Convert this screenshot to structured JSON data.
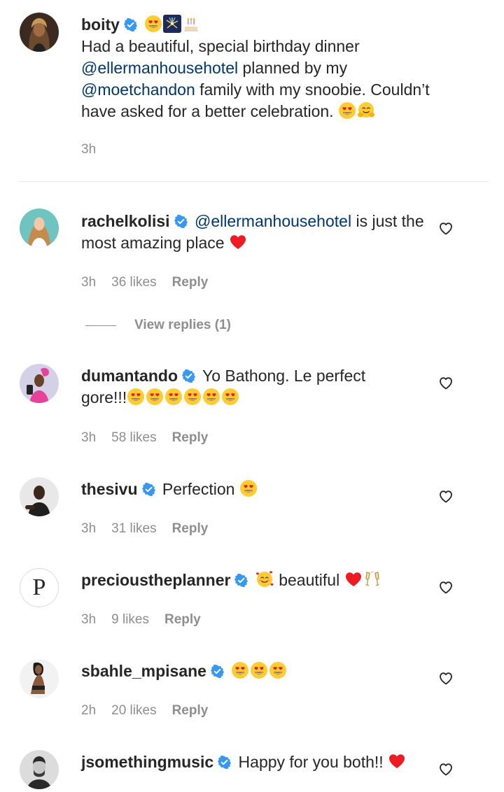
{
  "caption": {
    "username": "boity",
    "emoji_after_name": [
      "heart-eyes-emoji",
      "fireworks-emoji",
      "birthday-cake-emoji"
    ],
    "text_line1": "Had a beautiful, special birthday dinner",
    "mention1": "@ellermanhousehotel",
    "text_mid": " planned by my",
    "mention2": "@moetchandon",
    "text_end": " family with my snoobie. Couldn’t have asked for a better celebration. ",
    "time": "3h"
  },
  "comments": [
    {
      "username": "rachelkolisi",
      "mention": "@ellermanhousehotel",
      "text": " is just the most amazing place ",
      "time": "3h",
      "likes": "36 likes",
      "reply": "Reply"
    },
    {
      "username": "dumantando",
      "text": "Yo Bathong. Le perfect gore!!!",
      "time": "3h",
      "likes": "58 likes",
      "reply": "Reply"
    },
    {
      "username": "thesivu",
      "text": "Perfection ",
      "time": "3h",
      "likes": "31 likes",
      "reply": "Reply"
    },
    {
      "username": "precioustheplanner",
      "text": " beautiful ",
      "time": "3h",
      "likes": "9 likes",
      "reply": "Reply",
      "avatar_letter": "P"
    },
    {
      "username": "sbahle_mpisane",
      "text": "",
      "time": "2h",
      "likes": "20 likes",
      "reply": "Reply"
    },
    {
      "username": "jsomethingmusic",
      "text": "Happy for you both!! ",
      "time": "",
      "likes": "",
      "reply": ""
    }
  ],
  "view_replies": "View replies (1)",
  "colors": {
    "mention": "#00376b",
    "meta": "#8e8e8e",
    "verified": "#3897f0",
    "heart_red": "#ed1c24"
  }
}
